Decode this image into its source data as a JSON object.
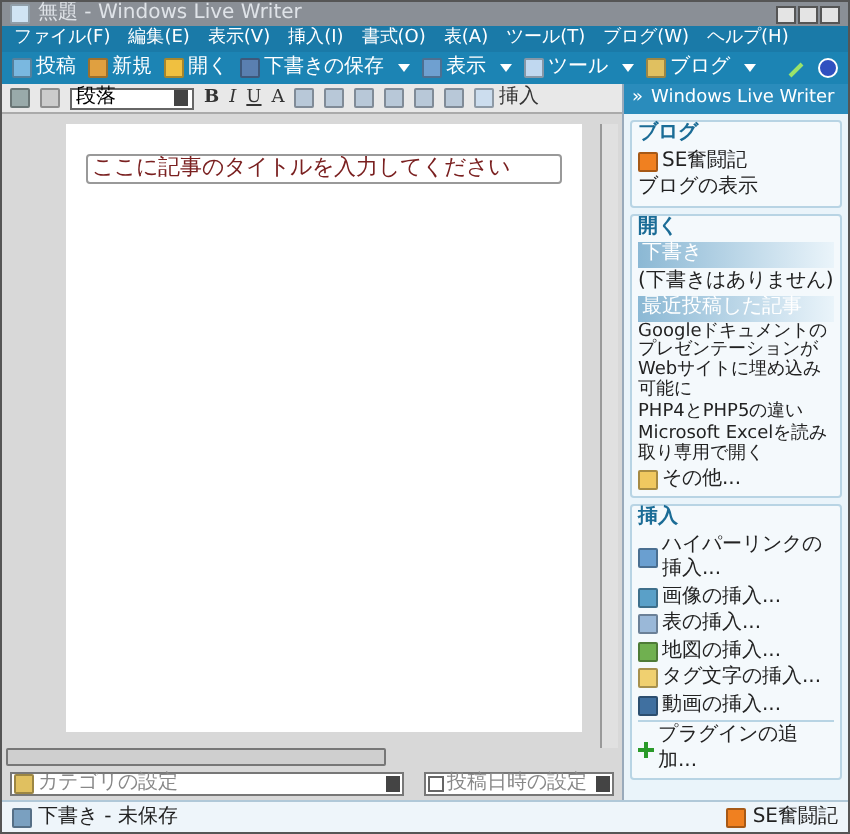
{
  "window": {
    "title": "無題 - Windows Live Writer"
  },
  "menu": [
    "ファイル(F)",
    "編集(E)",
    "表示(V)",
    "挿入(I)",
    "書式(O)",
    "表(A)",
    "ツール(T)",
    "ブログ(W)",
    "ヘルプ(H)"
  ],
  "toolbar": [
    {
      "label": "投稿",
      "dropdown": false
    },
    {
      "label": "新規",
      "dropdown": false
    },
    {
      "label": "開く",
      "dropdown": false
    },
    {
      "label": "下書きの保存",
      "dropdown": true
    },
    {
      "label": "表示",
      "dropdown": true
    },
    {
      "label": "ツール",
      "dropdown": true
    },
    {
      "label": "ブログ",
      "dropdown": true
    }
  ],
  "format_toolbar": {
    "paragraph_style": "段落",
    "buttons": [
      "B",
      "I",
      "U",
      "A"
    ],
    "insert": "挿入"
  },
  "editor": {
    "title_placeholder": "ここに記事のタイトルを入力してください"
  },
  "sidebar": {
    "header_glyph": "»",
    "header": "Windows Live Writer",
    "blog_section": {
      "title": "ブログ",
      "blog_name": "SE奮闘記",
      "view_link": "ブログの表示"
    },
    "open_section": {
      "title": "開く",
      "drafts_title": "下書き",
      "drafts_empty": "(下書きはありません)",
      "recent_title": "最近投稿した記事",
      "recent_posts": [
        "Googleドキュメントのプレゼンテーションが Webサイトに埋め込み可能に",
        "PHP4とPHP5の違い",
        "Microsoft Excelを読み取り専用で開く"
      ],
      "more": "その他..."
    },
    "insert_section": {
      "title": "挿入",
      "items": [
        "ハイパーリンクの挿入...",
        "画像の挿入...",
        "表の挿入...",
        "地図の挿入...",
        "タグ文字の挿入...",
        "動画の挿入..."
      ],
      "plugin": "プラグインの追加..."
    }
  },
  "bottom": {
    "category_placeholder": "カテゴリの設定",
    "date_label": "投稿日時の設定",
    "date_checked": false
  },
  "status_bar": {
    "text": "下書き - 未保存",
    "blog": "SE奮闘記"
  }
}
